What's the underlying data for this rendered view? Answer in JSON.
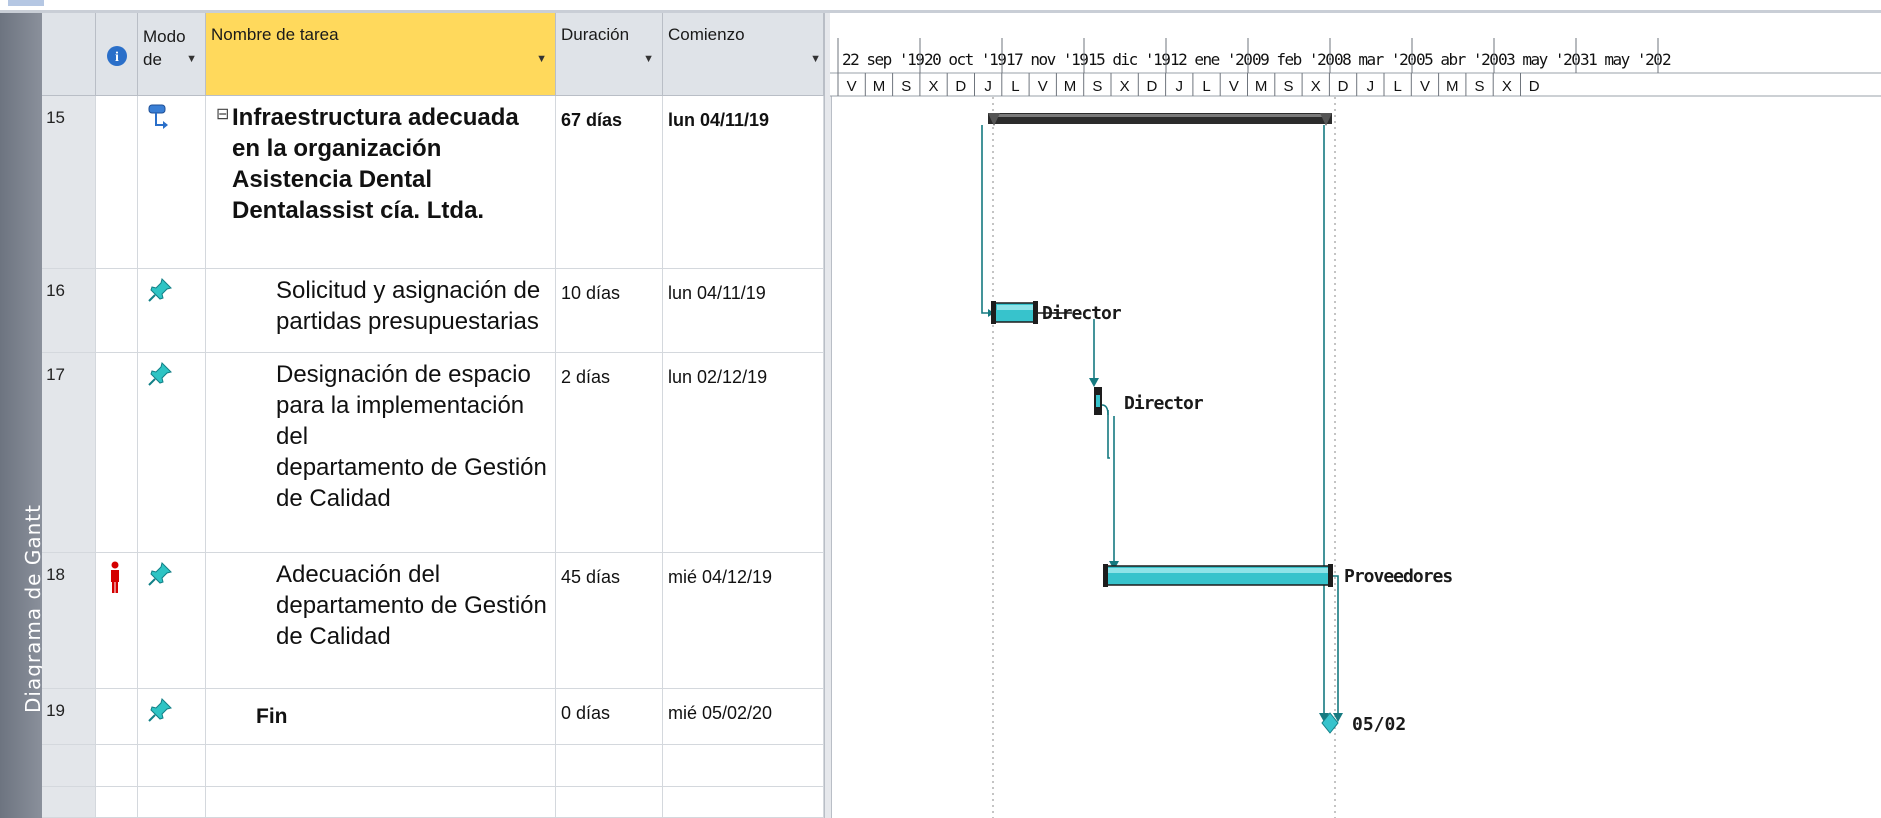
{
  "sidebar": {
    "label": "Diagrama de Gantt"
  },
  "columns": {
    "info_icon": "i",
    "mode": "Modo de",
    "name": "Nombre de tarea",
    "duration": "Duración",
    "start": "Comienzo"
  },
  "timescale": {
    "top": [
      "22 sep '19",
      "20 oct '19",
      "17 nov '19",
      "15 dic '19",
      "12 ene '20",
      "09 feb '20",
      "08 mar '20",
      "05 abr '20",
      "03 may '20",
      "31 may '20",
      "2"
    ],
    "bottom": [
      "V",
      "M",
      "S",
      "X",
      "D",
      "J",
      "L",
      "V",
      "M",
      "S",
      "X",
      "D",
      "J",
      "L",
      "V",
      "M",
      "S",
      "X",
      "D",
      "J",
      "L",
      "V",
      "M",
      "S",
      "X",
      "D"
    ]
  },
  "tasks": [
    {
      "id": "15",
      "name": "Infraestructura adecuada en la organización Asistencia Dental Dentalassist cía. Ltda.",
      "lines": [
        "Infraestructura adecuada",
        "en la organización",
        "Asistencia Dental",
        "Dentalassist cía. Ltda."
      ],
      "duration": "67 días",
      "start": "lun 04/11/19",
      "summary": true,
      "collapse_symbol": "⊟",
      "mode_icon": "auto-schedule-icon"
    },
    {
      "id": "16",
      "name": "Solicitud y asignación de partidas presupuestarias",
      "lines": [
        "Solicitud y asignación de",
        "partidas presupuestarias"
      ],
      "duration": "10 días",
      "start": "lun 04/11/19",
      "resource": "Director",
      "mode_icon": "manual-pin-icon"
    },
    {
      "id": "17",
      "name": "Designación de espacio para la implementación del departamento de Gestión de Calidad",
      "lines": [
        "Designación de espacio",
        "para la implementación del",
        "departamento de Gestión",
        "de Calidad"
      ],
      "duration": "2 días",
      "start": "lun 02/12/19",
      "resource": "Director",
      "mode_icon": "manual-pin-icon"
    },
    {
      "id": "18",
      "name": "Adecuación del departamento de Gestión de Calidad",
      "lines": [
        "Adecuación del",
        "departamento de Gestión",
        "de Calidad"
      ],
      "duration": "45 días",
      "start": "mié 04/12/19",
      "resource": "Proveedores",
      "indicator": "overallocated-person-icon",
      "mode_icon": "manual-pin-icon"
    },
    {
      "id": "19",
      "name": "Fin",
      "lines": [
        "Fin"
      ],
      "duration": "0 días",
      "start": "mié 05/02/20",
      "milestone_label": "05/02",
      "mode_icon": "manual-pin-icon"
    }
  ],
  "colors": {
    "task_bar": "#37c3cc",
    "summary_bar": "#2b2b2b",
    "link_line": "#157a80",
    "header_selected": "#ffd95c",
    "header": "#dfe3e8",
    "overallocated": "#d40000"
  }
}
